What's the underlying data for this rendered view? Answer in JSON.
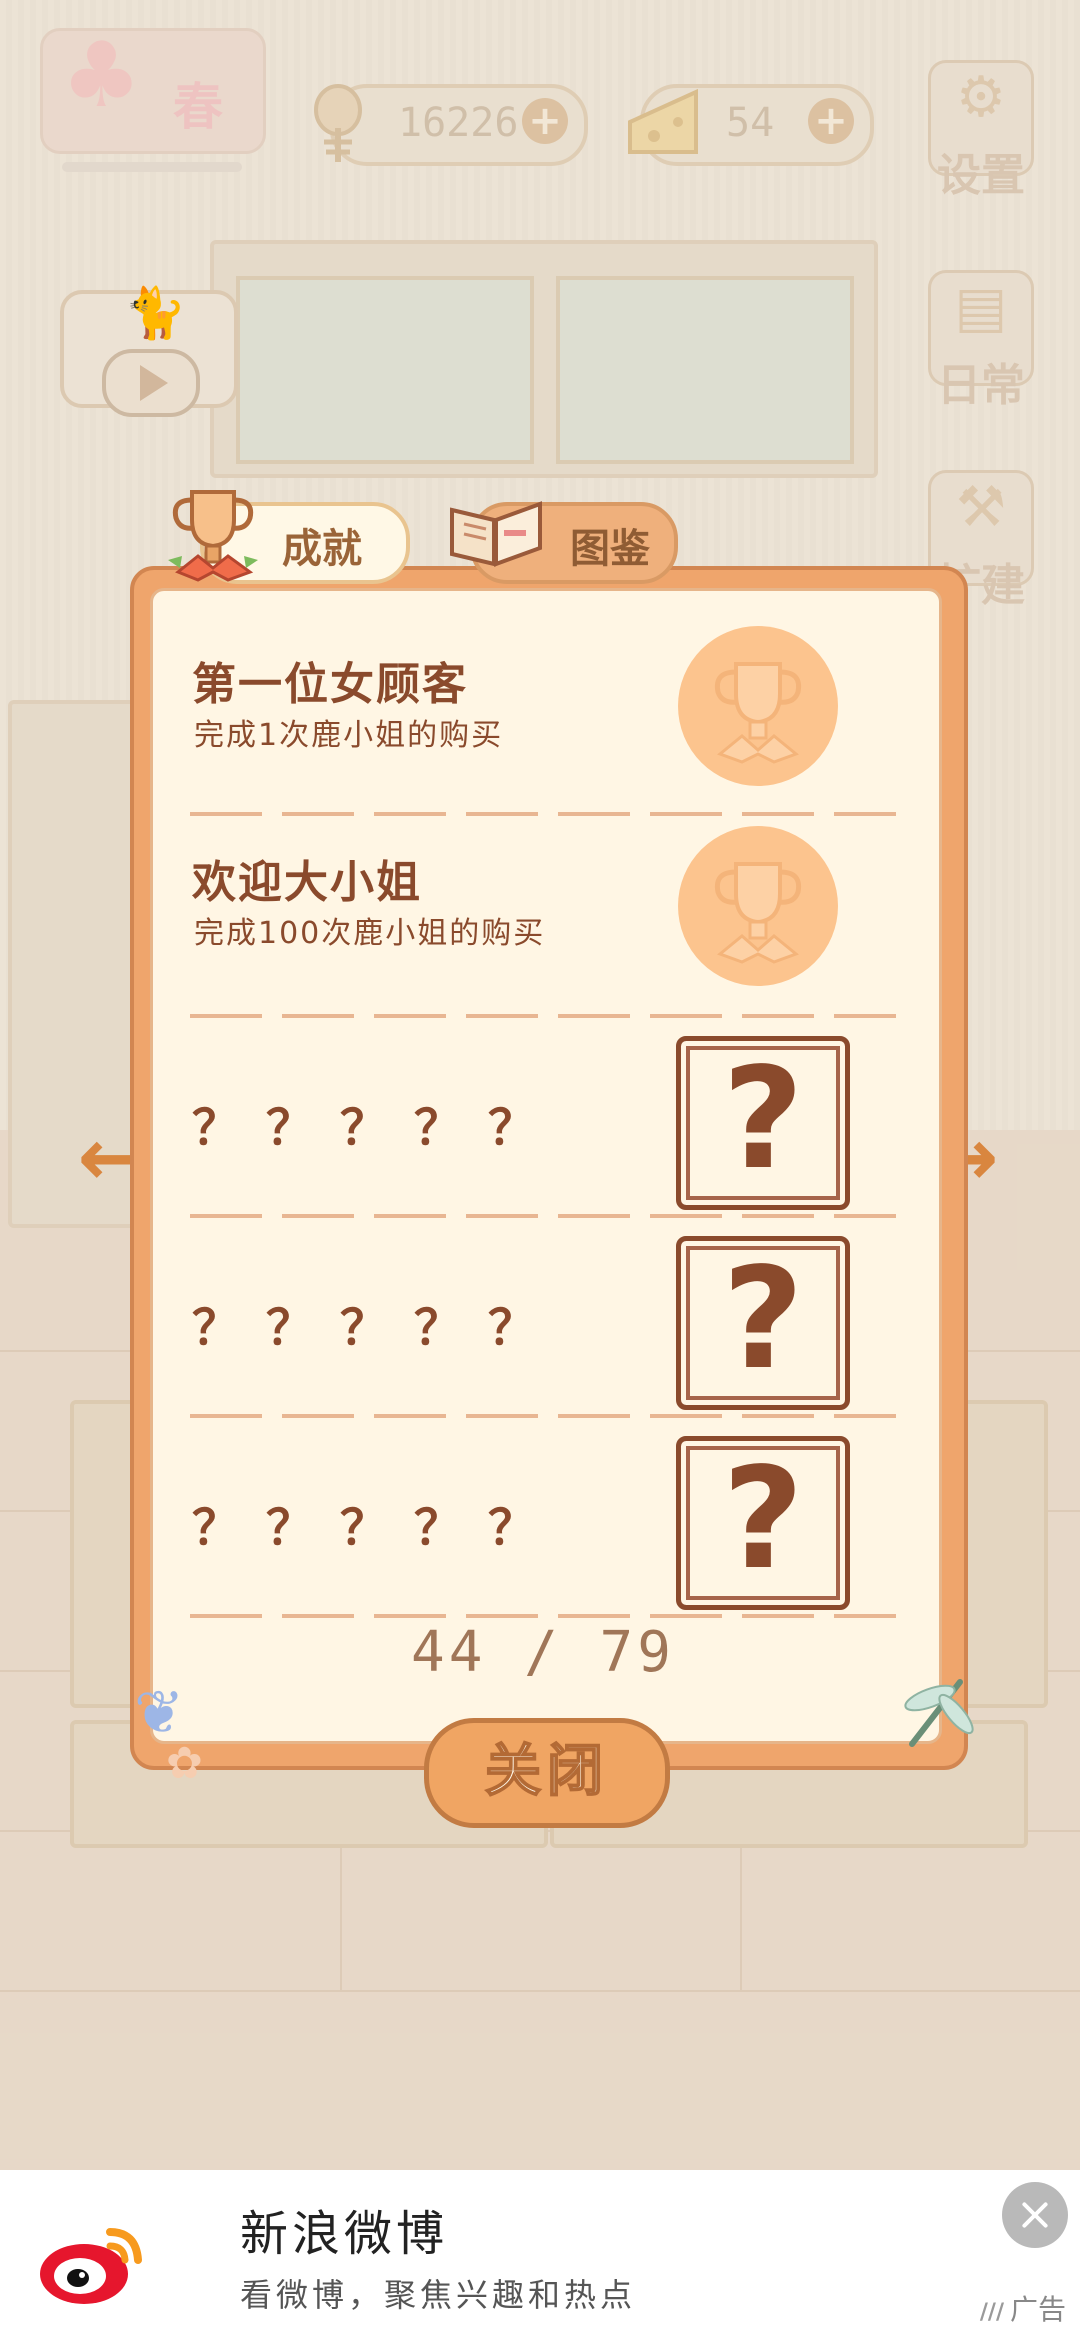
{
  "hud": {
    "season": "春",
    "fish_count": "16226",
    "cheese_count": "54",
    "plus_symbol": "+",
    "settings_label": "设置",
    "daily_label": "日常",
    "build_label": "扩建"
  },
  "tabs": {
    "active_label": "成就",
    "inactive_label": "图鉴"
  },
  "achievements": [
    {
      "title": "第一位女顾客",
      "desc": "完成1次鹿小姐的购买",
      "unlocked": true
    },
    {
      "title": "欢迎大小姐",
      "desc": "完成100次鹿小姐的购买",
      "unlocked": true
    },
    {
      "title": "？？？？？",
      "unlocked": false
    },
    {
      "title": "？？？？？",
      "unlocked": false
    },
    {
      "title": "？？？？？",
      "unlocked": false
    }
  ],
  "locked_symbol": "?",
  "progress": {
    "text": "44 / 79",
    "current": 44,
    "total": 79
  },
  "close_label": "关闭",
  "arrows": {
    "left": "←",
    "right": "→"
  },
  "ad": {
    "title": "新浪微博",
    "subtitle": "看微博，聚焦兴趣和热点",
    "tag": "广告"
  },
  "colors": {
    "panel_border": "#efa56c",
    "panel_bg": "#fff6e4",
    "text_brown": "#8a4a2c",
    "medal": "#fcc48e",
    "arrow": "#d9863f",
    "weibo_red": "#e6162d"
  },
  "icons": [
    "tree-icon",
    "fish-bone-icon",
    "cheese-icon",
    "plus-icon",
    "gear-icon",
    "daily-note-icon",
    "hammer-icon",
    "cat-icon",
    "play-icon",
    "trophy-icon",
    "book-icon",
    "question-icon",
    "arrow-left-icon",
    "arrow-right-icon",
    "butterfly-icon",
    "dragonfly-icon",
    "weibo-logo-icon",
    "close-icon"
  ]
}
